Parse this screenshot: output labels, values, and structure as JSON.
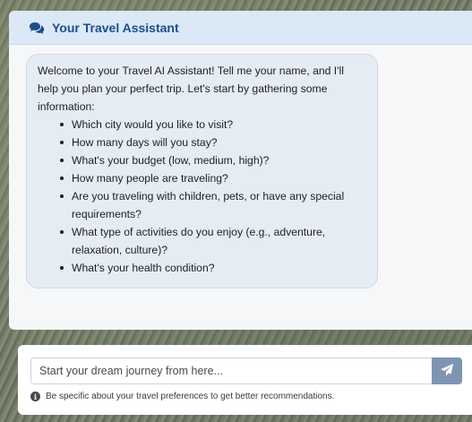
{
  "header": {
    "icon": "comments-icon",
    "title": "Your Travel Assistant"
  },
  "assistant_message": {
    "intro": "Welcome to your Travel AI Assistant! Tell me your name, and I'll help you plan your perfect trip. Let's start by gathering some information:",
    "questions": [
      "Which city would you like to visit?",
      "How many days will you stay?",
      "What's your budget (low, medium, high)?",
      "How many people are traveling?",
      "Are you traveling with children, pets, or have any special requirements?",
      "What type of activities do you enjoy (e.g., adventure, relaxation, culture)?",
      "What's your health condition?"
    ]
  },
  "composer": {
    "placeholder": "Start your dream journey from here...",
    "value": "",
    "send_icon": "paper-plane-icon",
    "hint_icon": "info-circle-icon",
    "hint": "Be specific about your travel preferences to get better recommendations."
  },
  "colors": {
    "header_bg": "#dbe8f6",
    "header_text": "#1b4f8a",
    "bubble_bg": "#e6ecf4",
    "send_button": "#7d95b3"
  }
}
